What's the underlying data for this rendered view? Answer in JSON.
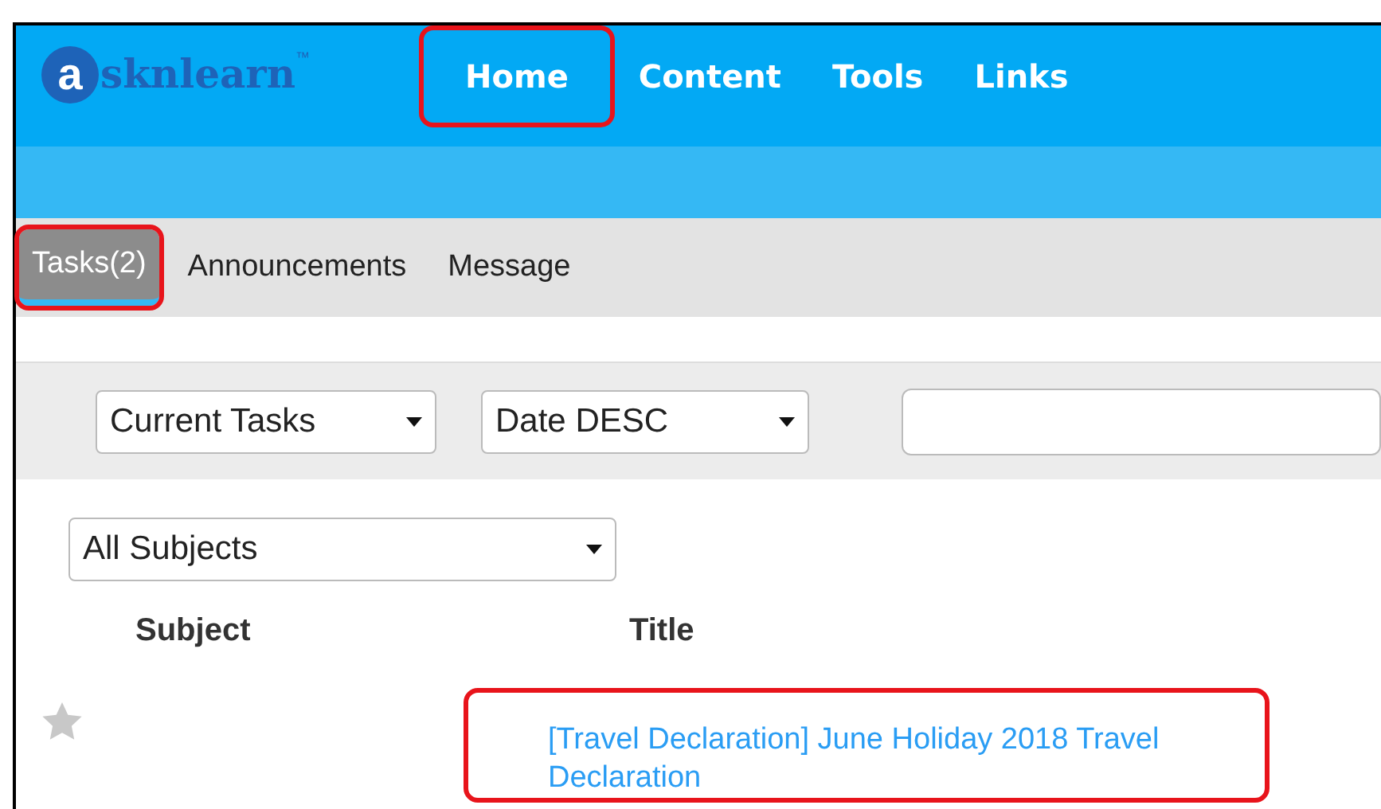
{
  "logo": {
    "initial": "a",
    "rest": "sknlearn",
    "mark": "™"
  },
  "nav": [
    {
      "label": "Home",
      "highlighted": true
    },
    {
      "label": "Content",
      "highlighted": false
    },
    {
      "label": "Tools",
      "highlighted": false
    },
    {
      "label": "Links",
      "highlighted": false
    }
  ],
  "tabs": [
    {
      "label": "Tasks(2)",
      "selected": true,
      "highlighted": true
    },
    {
      "label": "Announcements",
      "selected": false,
      "highlighted": false
    },
    {
      "label": "Message",
      "selected": false,
      "highlighted": false
    }
  ],
  "filters": [
    {
      "value": "Current Tasks"
    },
    {
      "value": "Date DESC"
    }
  ],
  "subject_filter": {
    "value": "All Subjects"
  },
  "table": {
    "columns": [
      "Subject",
      "Title"
    ],
    "rows": [
      {
        "starred": false,
        "subject": "",
        "title": "[Travel Declaration] June Holiday 2018 Travel Declaration",
        "highlighted": true
      }
    ]
  }
}
